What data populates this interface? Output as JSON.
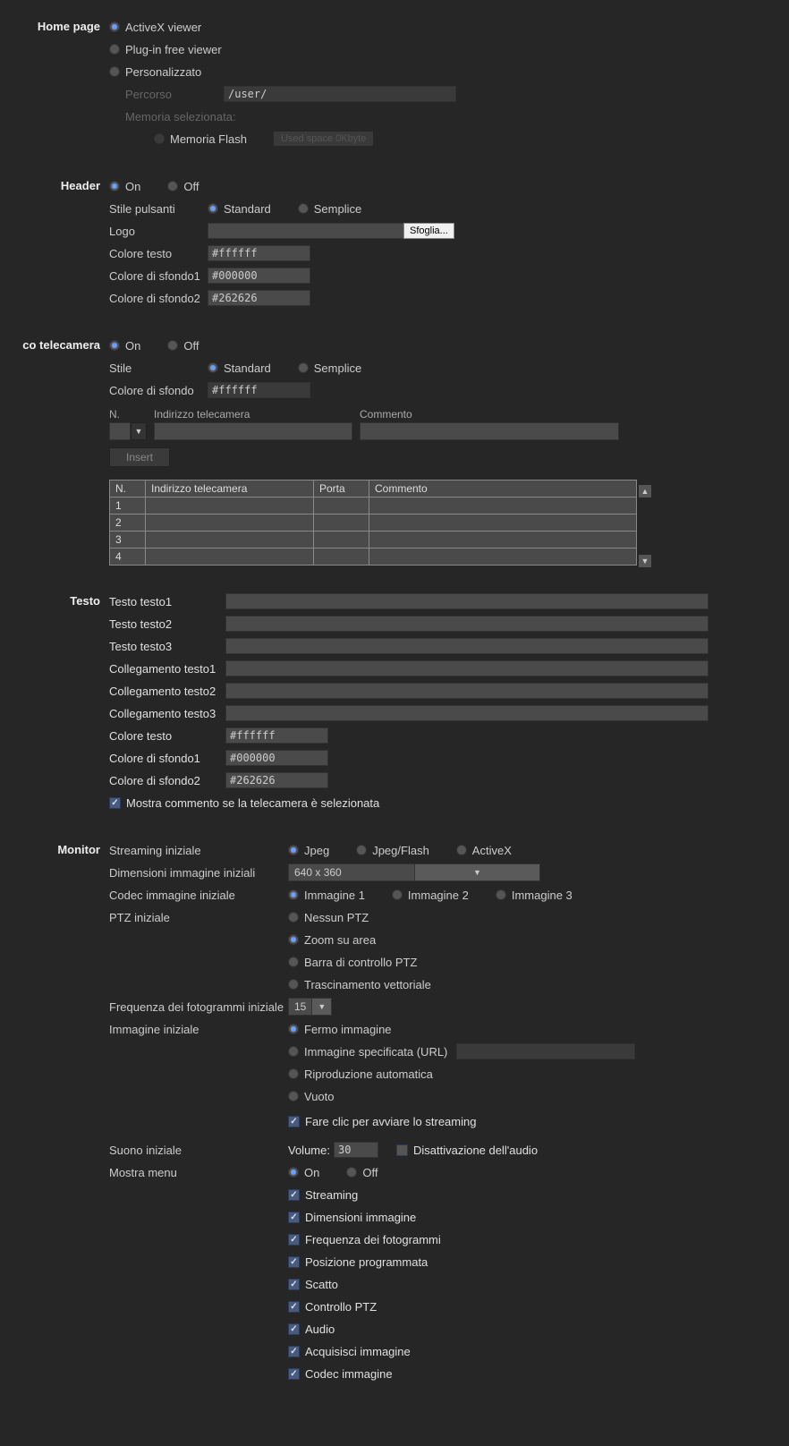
{
  "homepage": {
    "label": "Home page",
    "opt_activex": "ActiveX viewer",
    "opt_pluginfree": "Plug-in free viewer",
    "opt_custom": "Personalizzato",
    "path_label": "Percorso",
    "path_value": "/user/",
    "storage_label": "Memoria selezionata:",
    "storage_opt": "Memoria Flash",
    "storage_info": "Used space   0Kbyte"
  },
  "header": {
    "label": "Header",
    "on": "On",
    "off": "Off",
    "btn_style_label": "Stile pulsanti",
    "opt_standard": "Standard",
    "opt_simple": "Semplice",
    "logo_label": "Logo",
    "browse": "Sfoglia...",
    "text_color_label": "Colore testo",
    "text_color": "#ffffff",
    "bg1_label": "Colore di sfondo1",
    "bg1": "#000000",
    "bg2_label": "Colore di sfondo2",
    "bg2": "#262626"
  },
  "camera": {
    "label": "co telecamera",
    "on": "On",
    "off": "Off",
    "style_label": "Stile",
    "opt_standard": "Standard",
    "opt_simple": "Semplice",
    "bg_label": "Colore di sfondo",
    "bg": "#ffffff",
    "n_label": "N.",
    "addr_label": "Indirizzo telecamera",
    "comment_label": "Commento",
    "insert": "Insert",
    "th_n": "N.",
    "th_addr": "Indirizzo telecamera",
    "th_port": "Porta",
    "th_comment": "Commento",
    "rows": [
      "1",
      "2",
      "3",
      "4"
    ]
  },
  "testo": {
    "label": "Testo",
    "t1": "Testo testo1",
    "t2": "Testo testo2",
    "t3": "Testo testo3",
    "l1": "Collegamento testo1",
    "l2": "Collegamento testo2",
    "l3": "Collegamento testo3",
    "text_color_label": "Colore testo",
    "text_color": "#ffffff",
    "bg1_label": "Colore di sfondo1",
    "bg1": "#000000",
    "bg2_label": "Colore di sfondo2",
    "bg2": "#262626",
    "show_comment": "Mostra commento se la telecamera è selezionata"
  },
  "monitor": {
    "label": "Monitor",
    "stream_label": "Streaming iniziale",
    "opt_jpeg": "Jpeg",
    "opt_jpegflash": "Jpeg/Flash",
    "opt_activex": "ActiveX",
    "dim_label": "Dimensioni immagine iniziali",
    "dim_value": "640 x 360",
    "codec_label": "Codec immagine iniziale",
    "codec1": "Immagine 1",
    "codec2": "Immagine 2",
    "codec3": "Immagine 3",
    "ptz_label": "PTZ iniziale",
    "ptz_none": "Nessun PTZ",
    "ptz_zoom": "Zoom su area",
    "ptz_bar": "Barra di controllo PTZ",
    "ptz_drag": "Trascinamento vettoriale",
    "fps_label": "Frequenza dei fotogrammi iniziale",
    "fps_value": "15",
    "img_label": "Immagine iniziale",
    "img_still": "Fermo immagine",
    "img_url": "Immagine specificata (URL)",
    "img_auto": "Riproduzione automatica",
    "img_empty": "Vuoto",
    "click_start": "Fare clic per avviare lo streaming",
    "sound_label": "Suono iniziale",
    "volume_label": "Volume:",
    "volume_value": "30",
    "mute_label": "Disattivazione dell'audio",
    "menu_label": "Mostra menu",
    "on": "On",
    "off": "Off",
    "m_stream": "Streaming",
    "m_dim": "Dimensioni immagine",
    "m_fps": "Frequenza dei fotogrammi",
    "m_preset": "Posizione programmata",
    "m_shot": "Scatto",
    "m_ptz": "Controllo PTZ",
    "m_audio": "Audio",
    "m_capture": "Acquisisci immagine",
    "m_codec": "Codec immagine"
  }
}
